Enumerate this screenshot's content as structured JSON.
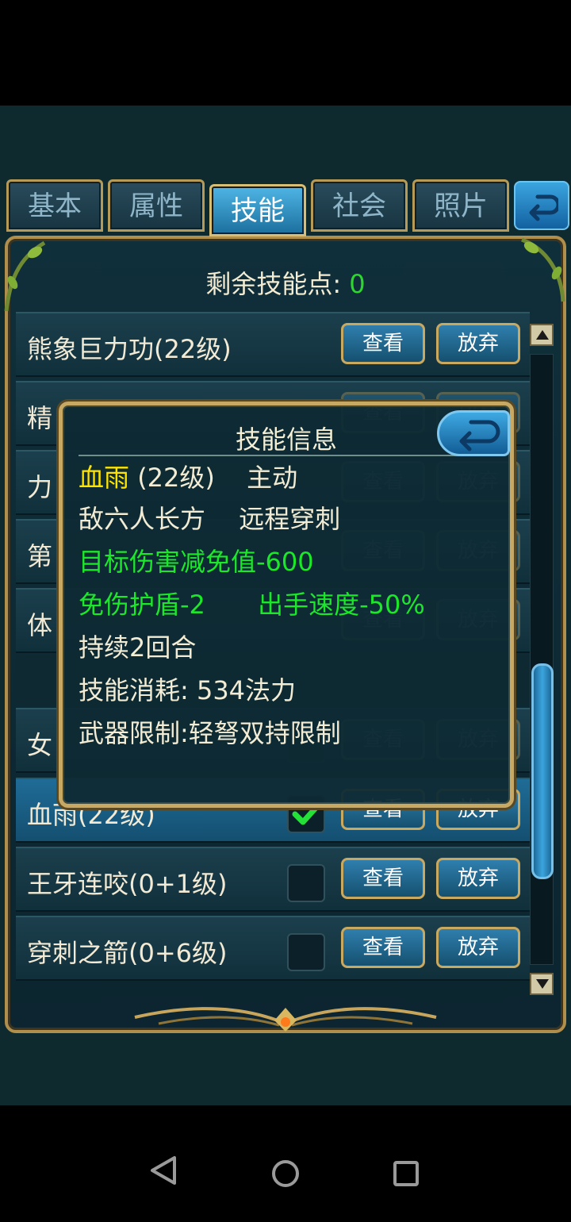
{
  "tabs": [
    {
      "label": "基本"
    },
    {
      "label": "属性"
    },
    {
      "label": "技能"
    },
    {
      "label": "社会"
    },
    {
      "label": "照片"
    }
  ],
  "skill_points": {
    "label": "剩余技能点:",
    "value": "0"
  },
  "buttons": {
    "view": "查看",
    "drop": "放弃"
  },
  "skills": [
    {
      "name": "熊象巨力功(22级)"
    },
    {
      "name": "精"
    },
    {
      "name": "力"
    },
    {
      "name": "第"
    },
    {
      "name": "体"
    },
    {
      "name": "女"
    },
    {
      "name": "血雨(22级)"
    },
    {
      "name": "王牙连咬(0+1级)"
    },
    {
      "name": "穿刺之箭(0+6级)"
    }
  ],
  "popup": {
    "title": "技能信息",
    "skill_name": "血雨",
    "level": "(22级)",
    "type": "主动",
    "target": "敌六人长方",
    "attack": "远程穿刺",
    "damage_reduction": "目标伤害减免值-600",
    "shield": "免伤护盾-2",
    "speed": "出手速度-50%",
    "duration": "持续2回合",
    "cost": "技能消耗: 534法力",
    "weapon": "武器限制:轻弩双持限制"
  },
  "colors": {
    "accent_yellow": "#ffe400",
    "accent_green": "#1ce82a",
    "frame_gold": "#c8a964"
  }
}
